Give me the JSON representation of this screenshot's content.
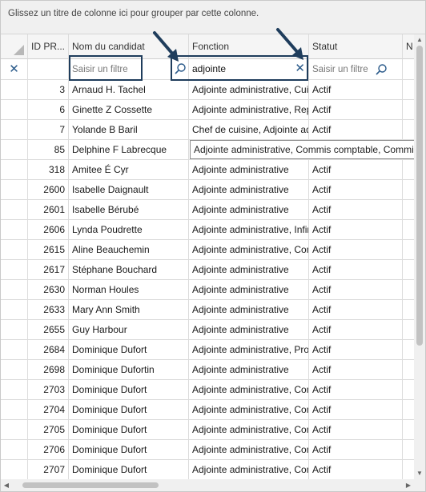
{
  "group_panel": {
    "hint": "Glissez un titre de colonne ici pour grouper par cette colonne."
  },
  "columns": {
    "id": "ID PR...",
    "nom": "Nom du candidat",
    "fonction": "Fonction",
    "statut": "Statut",
    "n": "N"
  },
  "filters": {
    "nom_placeholder": "Saisir un filtre",
    "fonction_value": "adjointe",
    "statut_placeholder": "Saisir un filtre",
    "clear_all_icon": "close-icon"
  },
  "rows": [
    {
      "id": "3",
      "nom": "Arnaud H. Tachel",
      "fonction": "Adjointe administrative, Cuis...",
      "statut": "Actif"
    },
    {
      "id": "6",
      "nom": "Ginette Z Cossette",
      "fonction": "Adjointe administrative, Rep...",
      "statut": "Actif"
    },
    {
      "id": "7",
      "nom": "Yolande B Baril",
      "fonction": "Chef de cuisine, Adjointe ad...",
      "statut": "Actif"
    },
    {
      "id": "85",
      "nom": "Delphine F Labrecque",
      "fonction": "",
      "statut": ""
    },
    {
      "id": "318",
      "nom": "Amitee É Cyr",
      "fonction": "Adjointe administrative",
      "statut": "Actif"
    },
    {
      "id": "2600",
      "nom": "Isabelle Daignault",
      "fonction": "Adjointe administrative",
      "statut": "Actif"
    },
    {
      "id": "2601",
      "nom": "Isabelle Bérubé",
      "fonction": "Adjointe administrative",
      "statut": "Actif"
    },
    {
      "id": "2606",
      "nom": "Lynda Poudrette",
      "fonction": "Adjointe administrative, Infir...",
      "statut": "Actif"
    },
    {
      "id": "2615",
      "nom": "Aline Beauchemin",
      "fonction": "Adjointe administrative, Com...",
      "statut": "Actif"
    },
    {
      "id": "2617",
      "nom": "Stéphane Bouchard",
      "fonction": "Adjointe administrative",
      "statut": "Actif"
    },
    {
      "id": "2630",
      "nom": "Norman Houles",
      "fonction": "Adjointe administrative",
      "statut": "Actif"
    },
    {
      "id": "2633",
      "nom": "Mary Ann Smith",
      "fonction": "Adjointe administrative",
      "statut": "Actif"
    },
    {
      "id": "2655",
      "nom": "Guy Harbour",
      "fonction": "Adjointe administrative",
      "statut": "Actif"
    },
    {
      "id": "2684",
      "nom": "Dominique Dufort",
      "fonction": "Adjointe administrative, Pro...",
      "statut": "Actif"
    },
    {
      "id": "2698",
      "nom": "Dominique Dufortin",
      "fonction": "Adjointe administrative",
      "statut": "Actif"
    },
    {
      "id": "2703",
      "nom": "Dominique Dufort",
      "fonction": "Adjointe administrative, Com...",
      "statut": "Actif"
    },
    {
      "id": "2704",
      "nom": "Dominique Dufort",
      "fonction": "Adjointe administrative, Com...",
      "statut": "Actif"
    },
    {
      "id": "2705",
      "nom": "Dominique Dufort",
      "fonction": "Adjointe administrative, Com...",
      "statut": "Actif"
    },
    {
      "id": "2706",
      "nom": "Dominique Dufort",
      "fonction": "Adjointe administrative, Com...",
      "statut": "Actif"
    },
    {
      "id": "2707",
      "nom": "Dominique Dufort",
      "fonction": "Adjointe administrative, Com...",
      "statut": "Actif"
    }
  ],
  "tooltip": {
    "text": "Adjointe administrative, Commis comptable, Commis aux pièces"
  },
  "colors": {
    "highlight": "#1f3d5c",
    "accent": "#2a5a8a"
  }
}
